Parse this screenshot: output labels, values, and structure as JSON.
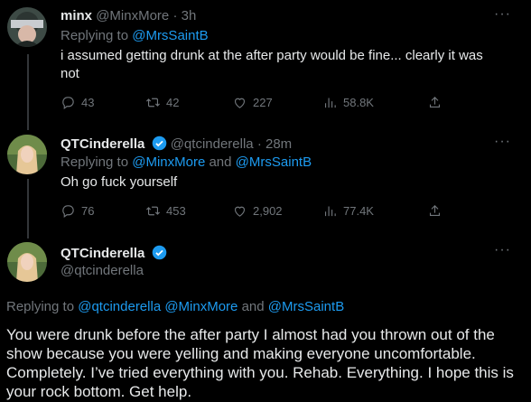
{
  "tweets": [
    {
      "name": "minx",
      "handle": "@MinxMore",
      "separator": "·",
      "time": "3h",
      "replying_prefix": "Replying to ",
      "replying_to": "@MrsSaintB",
      "text": "i assumed getting drunk at the after party would be fine... clearly it was not",
      "replies": "43",
      "retweets": "42",
      "likes": "227",
      "views": "58.8K",
      "more": "···"
    },
    {
      "name": "QTCinderella",
      "handle": "@qtcinderella",
      "separator": "·",
      "time": "28m",
      "replying_prefix": "Replying to ",
      "replying_to_1": "@MinxMore",
      "replying_and": " and ",
      "replying_to_2": "@MrsSaintB",
      "text": "Oh go fuck yourself",
      "replies": "76",
      "retweets": "453",
      "likes": "2,902",
      "views": "77.4K",
      "more": "···"
    }
  ],
  "main_tweet": {
    "name": "QTCinderella",
    "handle": "@qtcinderella",
    "replying_prefix": "Replying to ",
    "replying_to": "@qtcinderella @MinxMore",
    "replying_and": " and ",
    "replying_to_2": "@MrsSaintB",
    "text": "You were drunk before the after party I almost had you thrown out of the show because you were yelling and making everyone uncomfortable. Completely. I’ve tried everything with you. Rehab. Everything. I hope this is your rock bottom. Get help.",
    "more": "···"
  },
  "colors": {
    "background": "#000000",
    "text": "#e7e9ea",
    "muted": "#71767b",
    "link": "#1d9bf0",
    "verified": "#1d9bf0"
  },
  "icons": [
    "reply-icon",
    "retweet-icon",
    "like-icon",
    "views-icon",
    "share-icon",
    "more-icon",
    "verified-badge-icon"
  ]
}
